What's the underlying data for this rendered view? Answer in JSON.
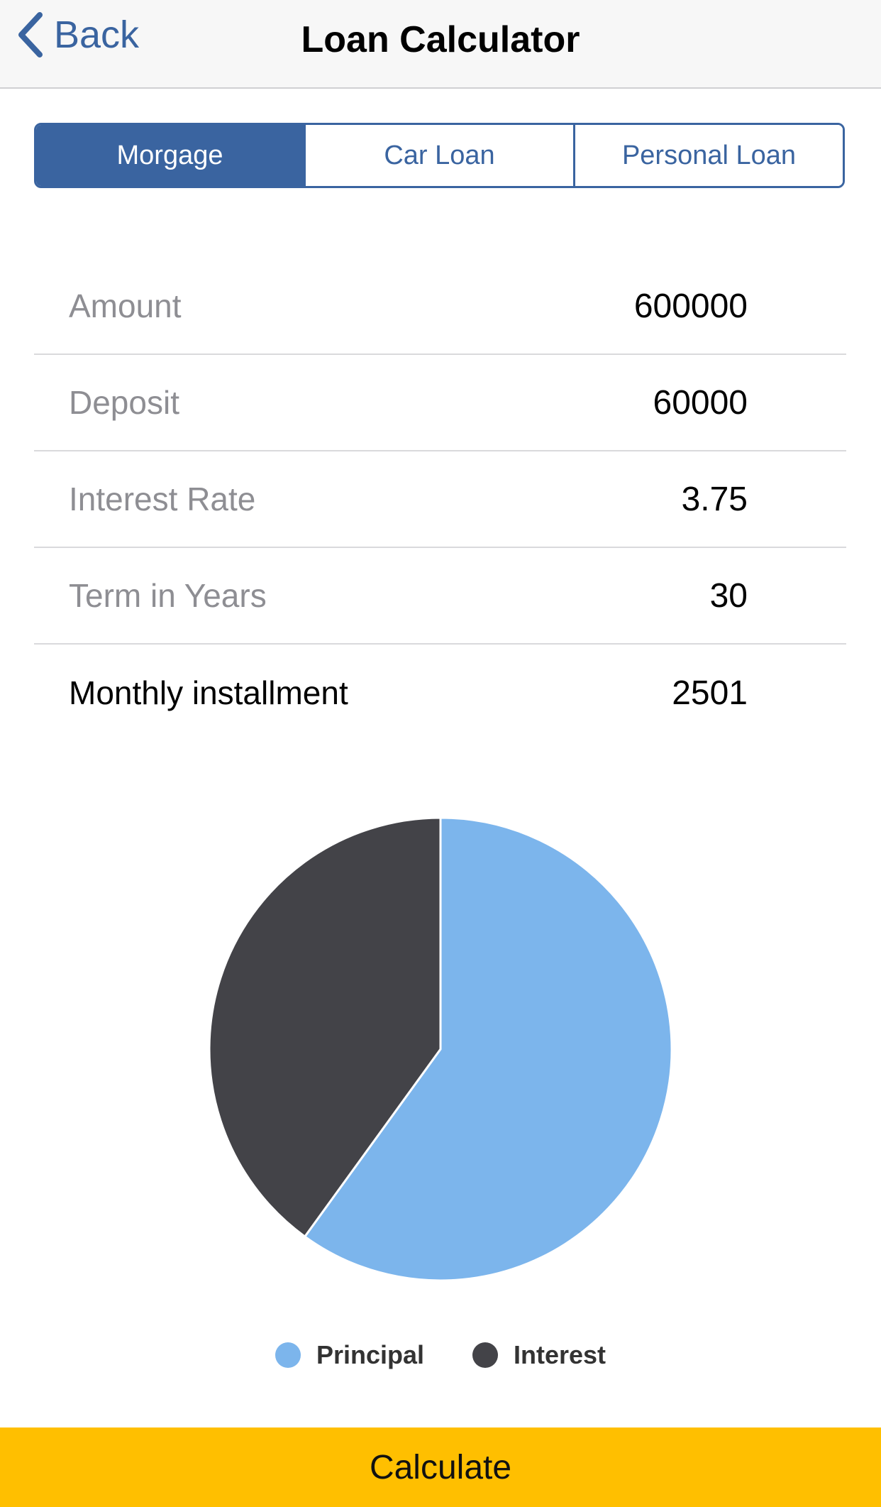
{
  "nav": {
    "back_label": "Back",
    "title": "Loan Calculator"
  },
  "segments": [
    {
      "label": "Morgage",
      "selected": true
    },
    {
      "label": "Car Loan",
      "selected": false
    },
    {
      "label": "Personal Loan",
      "selected": false
    }
  ],
  "form": {
    "rows": [
      {
        "label": "Amount",
        "value": "600000"
      },
      {
        "label": "Deposit",
        "value": "60000"
      },
      {
        "label": "Interest Rate",
        "value": "3.75"
      },
      {
        "label": "Term in Years",
        "value": "30"
      }
    ],
    "result": {
      "label": "Monthly installment",
      "value": "2501"
    }
  },
  "chart_data": {
    "type": "pie",
    "slices": [
      {
        "name": "Principal",
        "value": 540000,
        "color": "#7cb5ec"
      },
      {
        "name": "Interest",
        "value": 360360,
        "color": "#434348"
      }
    ]
  },
  "colors": {
    "accent": "#3a64a0",
    "button": "#ffbf00"
  },
  "calculate_label": "Calculate"
}
